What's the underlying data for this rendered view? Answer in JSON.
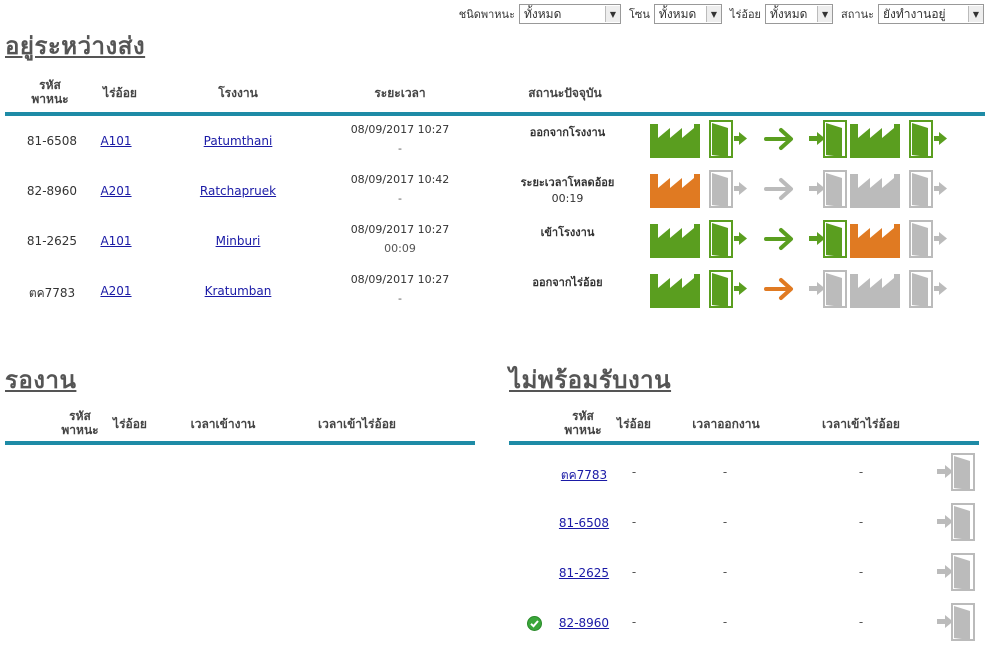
{
  "filters": [
    {
      "label": "ชนิดพาหนะ",
      "value": "ทั้งหมด"
    },
    {
      "label": "โซน",
      "value": "ทั้งหมด"
    },
    {
      "label": "ไร่อ้อย",
      "value": "ทั้งหมด"
    },
    {
      "label": "สถานะ",
      "value": "ยังทำงานอยู่"
    }
  ],
  "in_transit": {
    "title": "อยู่ระหว่างส่ง",
    "headers": [
      "รหัสพาหนะ",
      "ไร่อ้อย",
      "โรงงาน",
      "ระยะเวลา",
      "สถานะปัจจุบัน"
    ],
    "rows": [
      {
        "vehicle": "81-6508",
        "farm": "A101",
        "factory": "Patumthani",
        "time": "08/09/2017 10:27",
        "duration": "-",
        "status": "ออกจากโรงงาน",
        "status_sub": "",
        "icon_colors": [
          "#5a9e1f",
          "#5a9e1f",
          "#5a9e1f",
          "#5a9e1f",
          "#5a9e1f",
          "#5a9e1f"
        ]
      },
      {
        "vehicle": "82-8960",
        "farm": "A201",
        "factory": "Ratchapruek",
        "time": "08/09/2017 10:42",
        "duration": "-",
        "status": "ระยะเวลาโหลดอ้อย",
        "status_sub": "00:19",
        "icon_colors": [
          "#e07a22",
          "#bbbbbb",
          "#bbbbbb",
          "#bbbbbb",
          "#bbbbbb",
          "#bbbbbb"
        ]
      },
      {
        "vehicle": "81-2625",
        "farm": "A101",
        "factory": "Minburi",
        "time": "08/09/2017 10:27",
        "duration": "00:09",
        "status": "เข้าโรงงาน",
        "status_sub": "",
        "icon_colors": [
          "#5a9e1f",
          "#5a9e1f",
          "#5a9e1f",
          "#5a9e1f",
          "#e07a22",
          "#bbbbbb"
        ]
      },
      {
        "vehicle": "ตค7783",
        "farm": "A201",
        "factory": "Kratumban",
        "time": "08/09/2017 10:27",
        "duration": "-",
        "status": "ออกจากไร่อ้อย",
        "status_sub": "",
        "icon_colors": [
          "#5a9e1f",
          "#5a9e1f",
          "#e07a22",
          "#bbbbbb",
          "#bbbbbb",
          "#bbbbbb"
        ]
      }
    ]
  },
  "waiting": {
    "title": "รองาน",
    "headers": [
      "รหัสพาหนะ",
      "ไร่อ้อย",
      "เวลาเข้างาน",
      "เวลาเข้าไร่อ้อย"
    ]
  },
  "not_ready": {
    "title": "ไม่พร้อมรับงาน",
    "headers": [
      "รหัสพาหนะ",
      "ไร่อ้อย",
      "เวลาออกงาน",
      "เวลาเข้าไร่อ้อย"
    ],
    "rows": [
      {
        "vehicle": "ตค7783",
        "farm": "-",
        "out_time": "-",
        "farm_time": "-",
        "check": false
      },
      {
        "vehicle": "81-6508",
        "farm": "-",
        "out_time": "-",
        "farm_time": "-",
        "check": false
      },
      {
        "vehicle": "81-2625",
        "farm": "-",
        "out_time": "-",
        "farm_time": "-",
        "check": false
      },
      {
        "vehicle": "82-8960",
        "farm": "-",
        "out_time": "-",
        "farm_time": "-",
        "check": true
      }
    ]
  },
  "icons": [
    "factory-icon",
    "door-exit-icon",
    "arrow-right-icon",
    "door-enter-icon",
    "factory-icon",
    "door-exit-icon",
    "check-circle-icon"
  ]
}
